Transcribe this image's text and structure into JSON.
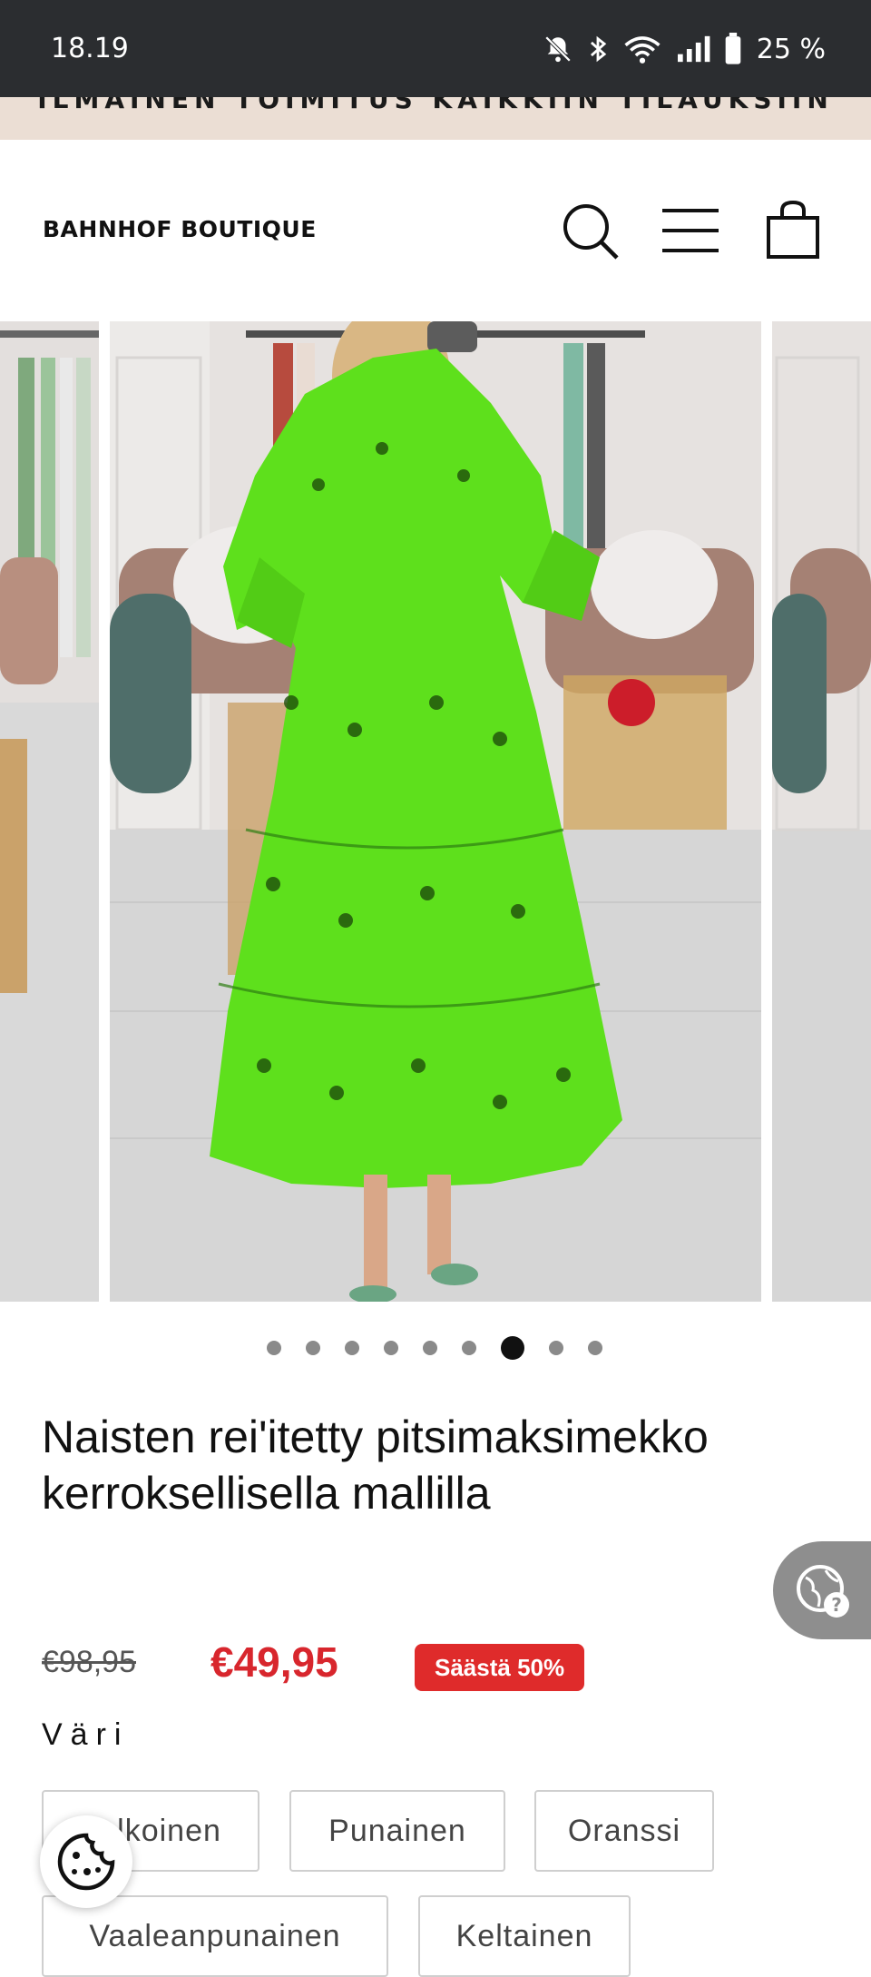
{
  "status_bar": {
    "time": "18.19",
    "battery": "25 %",
    "icons": [
      "notifications-muted-icon",
      "bluetooth-icon",
      "wifi-icon",
      "signal-icon",
      "battery-icon"
    ]
  },
  "announcement": {
    "text": "ILMAINEN TOIMITUS KAIKKIIN TILAUKSIIN"
  },
  "header": {
    "logo": "BAHNHOF BOUTIQUE",
    "icons": [
      "search-icon",
      "menu-icon",
      "cart-icon"
    ]
  },
  "gallery": {
    "slide_count": 9,
    "active_index": 6
  },
  "product": {
    "title": "Naisten rei'itetty pitsimaksimekko kerroksellisella mallilla",
    "price_original": "€98,95",
    "price_sale": "€49,95",
    "save_badge": "Säästä 50%",
    "color_label": "Väri",
    "colors": [
      "Valkoinen",
      "Punainen",
      "Oranssi",
      "Vaaleanpunainen",
      "Keltainen"
    ],
    "dress_color": "#5ee01c",
    "sale_color": "#d8262d"
  },
  "floating": {
    "globe_icon": "globe-help-icon",
    "cookie_icon": "cookie-icon"
  }
}
